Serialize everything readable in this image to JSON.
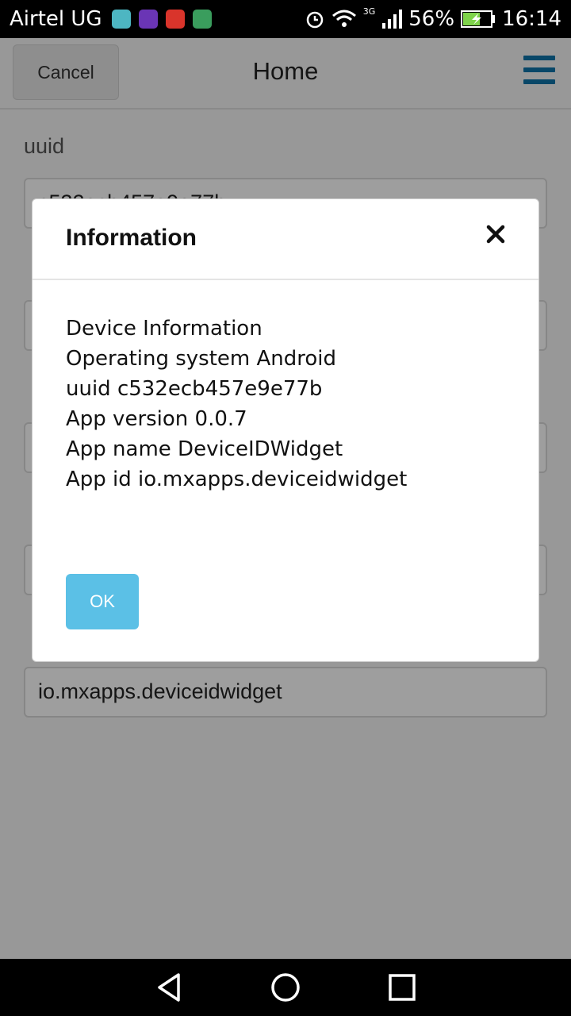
{
  "status_bar": {
    "carrier": "Airtel UG",
    "network": "3G",
    "battery": "56%",
    "time": "16:14",
    "app_icons": [
      {
        "name": "android-app-icon",
        "color": "#4db6c2"
      },
      {
        "name": "mail-app-icon",
        "color": "#6a35b5"
      },
      {
        "name": "huawei-app-icon",
        "color": "#d9342b"
      },
      {
        "name": "play-store-icon",
        "color": "#3a9d5d"
      }
    ]
  },
  "header": {
    "cancel_label": "Cancel",
    "title": "Home"
  },
  "form": {
    "uuid_label": "uuid",
    "uuid_value": "c532ecb457e9e77b",
    "app_id_value": "io.mxapps.deviceidwidget"
  },
  "dialog": {
    "title": "Information",
    "lines": [
      "Device Information",
      "Operating system Android",
      "uuid c532ecb457e9e77b",
      "App version 0.0.7",
      "App name DeviceIDWidget",
      "App id io.mxapps.deviceidwidget"
    ],
    "ok_label": "OK"
  },
  "colors": {
    "accent": "#0e73a8",
    "ok_button": "#5bc0e6"
  }
}
